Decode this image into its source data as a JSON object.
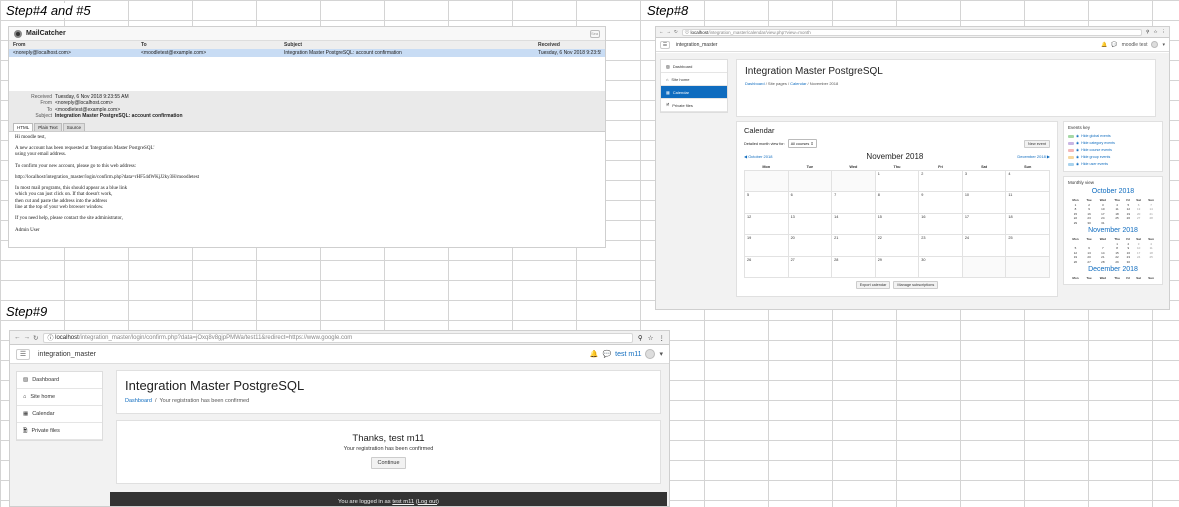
{
  "labels": {
    "step45": "Step#4 and #5",
    "step8": "Step#8",
    "step9": "Step#9"
  },
  "mailcatcher": {
    "title": "MailCatcher",
    "search_placeholder": "Sea",
    "columns": [
      "From",
      "To",
      "Subject",
      "Received"
    ],
    "message_row": {
      "from": "<noreply@localhost.com>",
      "to": "<moodletest@example.com>",
      "subject": "Integration Master PostgreSQL: account confirmation",
      "received": "Tuesday, 6 Nov 2018 9:23:55 AM"
    },
    "meta": [
      {
        "key": "Received",
        "value": "Tuesday, 6 Nov 2018 9:23:55 AM",
        "bold": false
      },
      {
        "key": "From",
        "value": "<noreply@localhost.com>",
        "bold": false
      },
      {
        "key": "To",
        "value": "<moodletest@example.com>",
        "bold": false
      },
      {
        "key": "Subject",
        "value": "Integration Master PostgreSQL: account confirmation",
        "bold": true
      }
    ],
    "tabs": [
      "HTML",
      "Plain Text",
      "Source"
    ],
    "body": [
      "Hi moodle test,",
      "",
      "A new account has been requested at 'Integration Master PostgreSQL'",
      "using your email address.",
      "",
      "To confirm your new account, please go to this web address:",
      "",
      "http://localhost/integration_master/login/confirm.php?data=rHF54dWKjJ2ky3H/moodletest",
      "",
      "In most mail programs, this should appear as a blue link",
      "which you can just click on. If that doesn't work,",
      "then cut and paste the address into the address",
      "line at the top of your web browser window.",
      "",
      "If you need help, please contact the site administrator,",
      "",
      "Admin User"
    ]
  },
  "calendar": {
    "url_host": "localhost",
    "url_rest": "/integration_master/calendar/view.php?view=month",
    "site_name": "integration_master",
    "user_name": "moodle test",
    "sidebar": [
      "Dashboard",
      "Site home",
      "Calendar",
      "Private files"
    ],
    "page_title": "Integration Master PostgreSQL",
    "breadcrumb": [
      "Dashboard",
      "Site pages",
      "Calendar",
      "November 2018"
    ],
    "heading": "Calendar",
    "filter_label": "Detailed month view for:",
    "filter_value": "All courses",
    "new_event": "New event",
    "prev_month": "October 2018",
    "next_month": "December 2018",
    "month_title": "November 2018",
    "weekdays": [
      "Mon",
      "Tue",
      "Wed",
      "Thu",
      "Fri",
      "Sat",
      "Sun"
    ],
    "weeks": [
      [
        "",
        "",
        "",
        "1",
        "2",
        "3",
        "4"
      ],
      [
        "5",
        "6",
        "7",
        "8",
        "9",
        "10",
        "11"
      ],
      [
        "12",
        "13",
        "14",
        "15",
        "16",
        "17",
        "18"
      ],
      [
        "19",
        "20",
        "21",
        "22",
        "23",
        "24",
        "25"
      ],
      [
        "26",
        "27",
        "28",
        "29",
        "30",
        "",
        ""
      ]
    ],
    "export_button": "Export calendar",
    "manage_button": "Manage subscriptions",
    "events_key_title": "Events key",
    "events_key": [
      {
        "label": "Hide global events",
        "color": "#a6d8a6"
      },
      {
        "label": "Hide category events",
        "color": "#c9b6e4"
      },
      {
        "label": "Hide course events",
        "color": "#f4b8b8"
      },
      {
        "label": "Hide group events",
        "color": "#f5d79e"
      },
      {
        "label": "Hide user events",
        "color": "#a9d3ee"
      }
    ],
    "monthly_view_title": "Monthly view",
    "mini_weekdays": [
      "Mon",
      "Tue",
      "Wed",
      "Thu",
      "Fri",
      "Sat",
      "Sun"
    ],
    "mini_months": [
      {
        "title": "October 2018",
        "weeks": [
          [
            "1",
            "2",
            "3",
            "4",
            "5",
            "6",
            "7"
          ],
          [
            "8",
            "9",
            "10",
            "11",
            "12",
            "13",
            "14"
          ],
          [
            "15",
            "16",
            "17",
            "18",
            "19",
            "20",
            "21"
          ],
          [
            "22",
            "23",
            "24",
            "25",
            "26",
            "27",
            "28"
          ],
          [
            "29",
            "30",
            "31",
            "",
            "",
            "",
            ""
          ]
        ]
      },
      {
        "title": "November 2018",
        "weeks": [
          [
            "",
            "",
            "",
            "1",
            "2",
            "3",
            "4"
          ],
          [
            "5",
            "6",
            "7",
            "8",
            "9",
            "10",
            "11"
          ],
          [
            "12",
            "13",
            "14",
            "15",
            "16",
            "17",
            "18"
          ],
          [
            "19",
            "20",
            "21",
            "22",
            "23",
            "24",
            "25"
          ],
          [
            "26",
            "27",
            "28",
            "29",
            "30",
            "",
            ""
          ]
        ]
      },
      {
        "title": "December 2018",
        "weeks": []
      }
    ]
  },
  "confirm": {
    "url_host": "localhost",
    "url_rest": "/integration_master/login/confirm.php?data=jOxq8v8gjpPMWa/test11&redirect=https://www.google.com",
    "site_name": "integration_master",
    "user_name": "test m11",
    "sidebar": [
      "Dashboard",
      "Site home",
      "Calendar",
      "Private files"
    ],
    "page_title": "Integration Master PostgreSQL",
    "breadcrumb": [
      "Dashboard",
      "Your registration has been confirmed"
    ],
    "thanks": "Thanks, test m11",
    "message": "Your registration has been confirmed",
    "continue_button": "Continue",
    "footer_prefix": "You are logged in as",
    "footer_user": "test m11",
    "footer_logout": "Log out"
  }
}
